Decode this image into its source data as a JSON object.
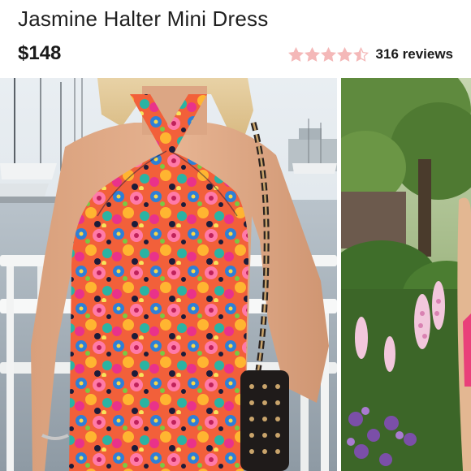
{
  "product": {
    "title": "Jasmine Halter Mini Dress",
    "price": "$148",
    "rating": 4.5,
    "rating_max": 5,
    "reviews_label": "316 reviews"
  },
  "colors": {
    "star": "#f4b8b8",
    "text": "#1a1a1a"
  },
  "gallery": {
    "images": [
      {
        "icon": "dress-photo-marina"
      },
      {
        "icon": "dress-photo-garden"
      }
    ]
  }
}
